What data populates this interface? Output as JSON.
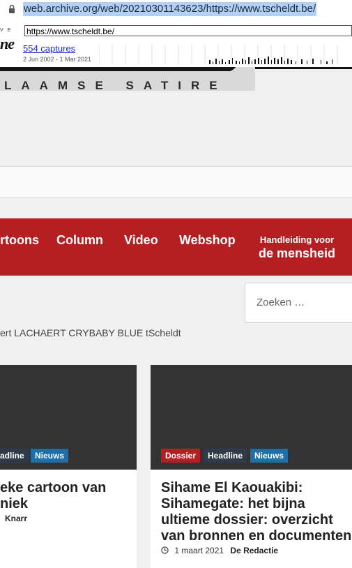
{
  "browser": {
    "url": "web.archive.org/web/20210301143623/https://www.tscheldt.be/"
  },
  "wayback": {
    "logo_small": "V E",
    "logo_large": "ne",
    "input_url": "https://www.tscheldt.be/",
    "captures": "554 captures",
    "range": "2 Jun 2002 - 1 Mar 2021"
  },
  "header": {
    "tagline": "LAAMSE SATIRE"
  },
  "nav": {
    "items": [
      "rtoons",
      "Column",
      "Video",
      "Webshop"
    ],
    "handleiding_line1": "Handleiding voor",
    "handleiding_line2": "de mensheid"
  },
  "search": {
    "placeholder": "Zoeken …"
  },
  "ticker": {
    "text": "ert LACHAERT CRYBABY BLUE tScheldt"
  },
  "cards": [
    {
      "tags": [
        "adline",
        "Nieuws"
      ],
      "title_lines": [
        "eke cartoon van",
        "niek"
      ],
      "author": "Knarr"
    },
    {
      "tags": [
        "Dossier",
        "Headline",
        "Nieuws"
      ],
      "title_lines": [
        "Sihame El Kaouakibi:",
        "Sihamegate: het bijna",
        "ultieme dossier: overzicht",
        "van bronnen en documenten"
      ],
      "date": "1 maart 2021",
      "author": "De Redactie"
    }
  ],
  "colors": {
    "nav_red": "#b51f22",
    "badge_blue": "#1c6fa8",
    "badge_dark": "#2f3b48",
    "thumb_dark": "#333333"
  }
}
